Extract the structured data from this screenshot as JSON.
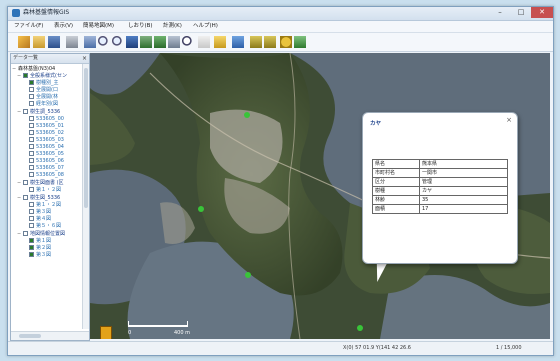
{
  "window": {
    "title": "森林基盤情報GIS"
  },
  "menubar": {
    "items": [
      "ファイル(F)",
      "表示(V)",
      "簡易地図(M)",
      "しおり(B)",
      "計測(K)",
      "ヘルプ(H)"
    ]
  },
  "sidebar": {
    "header": "データ一覧",
    "items": [
      {
        "label": "森林基盤(N3)04"
      },
      {
        "label": "全般系様式(セン"
      },
      {
        "label": "樹種別_主"
      },
      {
        "label": "全展開(口"
      },
      {
        "label": "全展開(林"
      },
      {
        "label": "経年別(図"
      },
      {
        "label": "樹生調_5336"
      },
      {
        "label": "533605_00"
      },
      {
        "label": "533605_01"
      },
      {
        "label": "533605_02"
      },
      {
        "label": "533605_03"
      },
      {
        "label": "533605_04"
      },
      {
        "label": "533605_05"
      },
      {
        "label": "533605_06"
      },
      {
        "label": "533605_07"
      },
      {
        "label": "533605_08"
      },
      {
        "label": "樹生図面書 (区"
      },
      {
        "label": "第１・２図"
      },
      {
        "label": "樹生図_5336"
      },
      {
        "label": "第１・２図"
      },
      {
        "label": "第３図"
      },
      {
        "label": "第４図"
      },
      {
        "label": "第５・６図"
      },
      {
        "label": "地図情報位置図"
      },
      {
        "label": "第１図"
      },
      {
        "label": "第２図"
      },
      {
        "label": "第３図"
      }
    ]
  },
  "popup": {
    "title": "カヤ",
    "rows": [
      {
        "key": "県名",
        "value": "熊本県"
      },
      {
        "key": "市町村名",
        "value": "一関市"
      },
      {
        "key": "区分",
        "value": "管理"
      },
      {
        "key": "樹種",
        "value": "カヤ"
      },
      {
        "key": "林齢",
        "value": "35"
      },
      {
        "key": "面積",
        "value": "17"
      }
    ]
  },
  "status": {
    "coords": "X(0) 57 01.9  Y(141 42 26.6",
    "scale": "1 / 15,000"
  },
  "scalebar": {
    "left_label": "0",
    "right_label": "400 m"
  }
}
